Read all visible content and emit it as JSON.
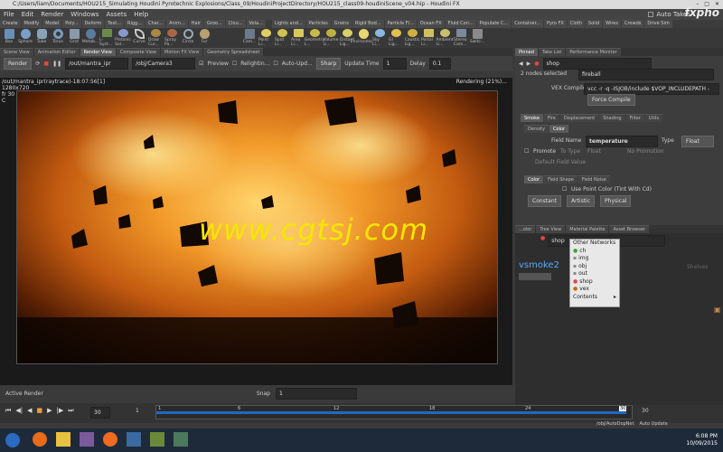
{
  "titlebar": {
    "path": "C:/Users/liam/Documents/HOU215_Simulating Houdini Pyrotechnic Explosions/Class_09/HoudiniProjectDirectory/HOU215_class09-houdiniScene_v04.hip - Houdini FX"
  },
  "menubar": {
    "items": [
      "File",
      "Edit",
      "Render",
      "Windows",
      "Assets",
      "Help"
    ],
    "auto_takes": "Auto Takes",
    "watermark_top": "fxpho"
  },
  "shelf_tabs": {
    "left": [
      "Create",
      "Modify",
      "Model",
      "Poly...",
      "Deform",
      "Text...",
      "Rigg...",
      "Char...",
      "Anim...",
      "Hair",
      "Groo...",
      "Clou...",
      "Vola..."
    ],
    "right": [
      "Lights and...",
      "Particles",
      "Grains",
      "Rigid Bod...",
      "Particle Fl...",
      "Ocean FX",
      "Fluid Con...",
      "Populate C...",
      "Container...",
      "Pyro FX",
      "Cloth",
      "Solid",
      "Wires",
      "Crowds",
      "Drive Sim"
    ]
  },
  "shelf_tools": {
    "left": [
      "Box",
      "Sphere",
      "Tube",
      "Torus",
      "Grid",
      "Metab...",
      "L-Syst...",
      "Platonic Sol...",
      "Curve",
      "Draw Cur...",
      "Spray Pa...",
      "Circle",
      "Fur"
    ],
    "right": [
      "Cam...",
      "Point Li...",
      "Spot Li...",
      "Area Li...",
      "Geometry L...",
      "Volume Li...",
      "Distant Lig...",
      "Environme...",
      "Sky Li...",
      "GI Lig...",
      "Caustic Lig...",
      "Portal Li...",
      "Ambient Li...",
      "Stereo Cam...",
      "Switc..."
    ]
  },
  "left_tabs": [
    "Scene View",
    "Animation Editor",
    "Render View",
    "Composite View",
    "Motion FX View",
    "Geometry Spreadsheet"
  ],
  "render_toolbar": {
    "render": "Render",
    "rop": "/out/mantra_ipr",
    "camera": "/obj/Camera3",
    "preview": "Preview",
    "relighting": "Relightin...",
    "auto_update": "Auto-Upd...",
    "sharp": "Sharp",
    "update_time_label": "Update Time",
    "update_time": "1",
    "delay_label": "Delay",
    "delay": "0.1"
  },
  "viewport": {
    "info": "/out/mantra_ipr(raytrace)-18:07:56[1]",
    "res": "1280x720",
    "frame": "fr 30",
    "c": "C",
    "status": "Rendering (21%)..."
  },
  "watermark": "www.cgtsj.com",
  "bottom": {
    "active_render": "Active Render",
    "snap_label": "Snap",
    "snap_value": "1"
  },
  "playbar": {
    "start": "1",
    "end": "30",
    "current": "30",
    "frame_field": "30",
    "ticks": [
      "1",
      "6",
      "12",
      "18",
      "24",
      "30"
    ],
    "auto_update": "Auto Update",
    "path": "/obj/AutoDopNet"
  },
  "right_tabs": [
    "Pinned",
    "Take List",
    "Performance Monitor"
  ],
  "params": {
    "node": "shop",
    "nodes_selected": "2 nodes selected",
    "node_name": "fireball",
    "vex_label": "VEX Compiler",
    "vex_value": "vcc -r -q -ISJOB/include $VOP_INCLUDEPATH -",
    "force_compile": "Force Compile",
    "tabs": [
      "Smoke",
      "Fire",
      "Displacement",
      "Shading",
      "Filter",
      "Utils"
    ],
    "subtabs": [
      "Density",
      "Color"
    ],
    "field_name_label": "Field Name",
    "field_name": "temperature",
    "type_label": "Type",
    "type_value": "Float",
    "promote": "Promote",
    "to_type_label": "To Type",
    "to_type": "Float",
    "no_promo": "No Promotion",
    "default_label": "Default Field Value",
    "color_tabs": [
      "Color",
      "Field Shape",
      "Field Noise"
    ],
    "use_point_color": "Use Point Color (Tint With Cd)",
    "modes": [
      "Constant",
      "Artistic",
      "Physical"
    ]
  },
  "network": {
    "tabs": [
      "...olor",
      "Tree View",
      "Material Palette",
      "Asset Browser"
    ],
    "path": "shop",
    "node_label": "vsmoke2",
    "header": "Shelves"
  },
  "context_menu": {
    "items": [
      "Other Networks",
      "ch",
      "img",
      "obj",
      "out",
      "shop",
      "vex",
      "Contents"
    ]
  },
  "taskbar": {
    "time": "6:08 PM",
    "date": "10/09/2015"
  }
}
